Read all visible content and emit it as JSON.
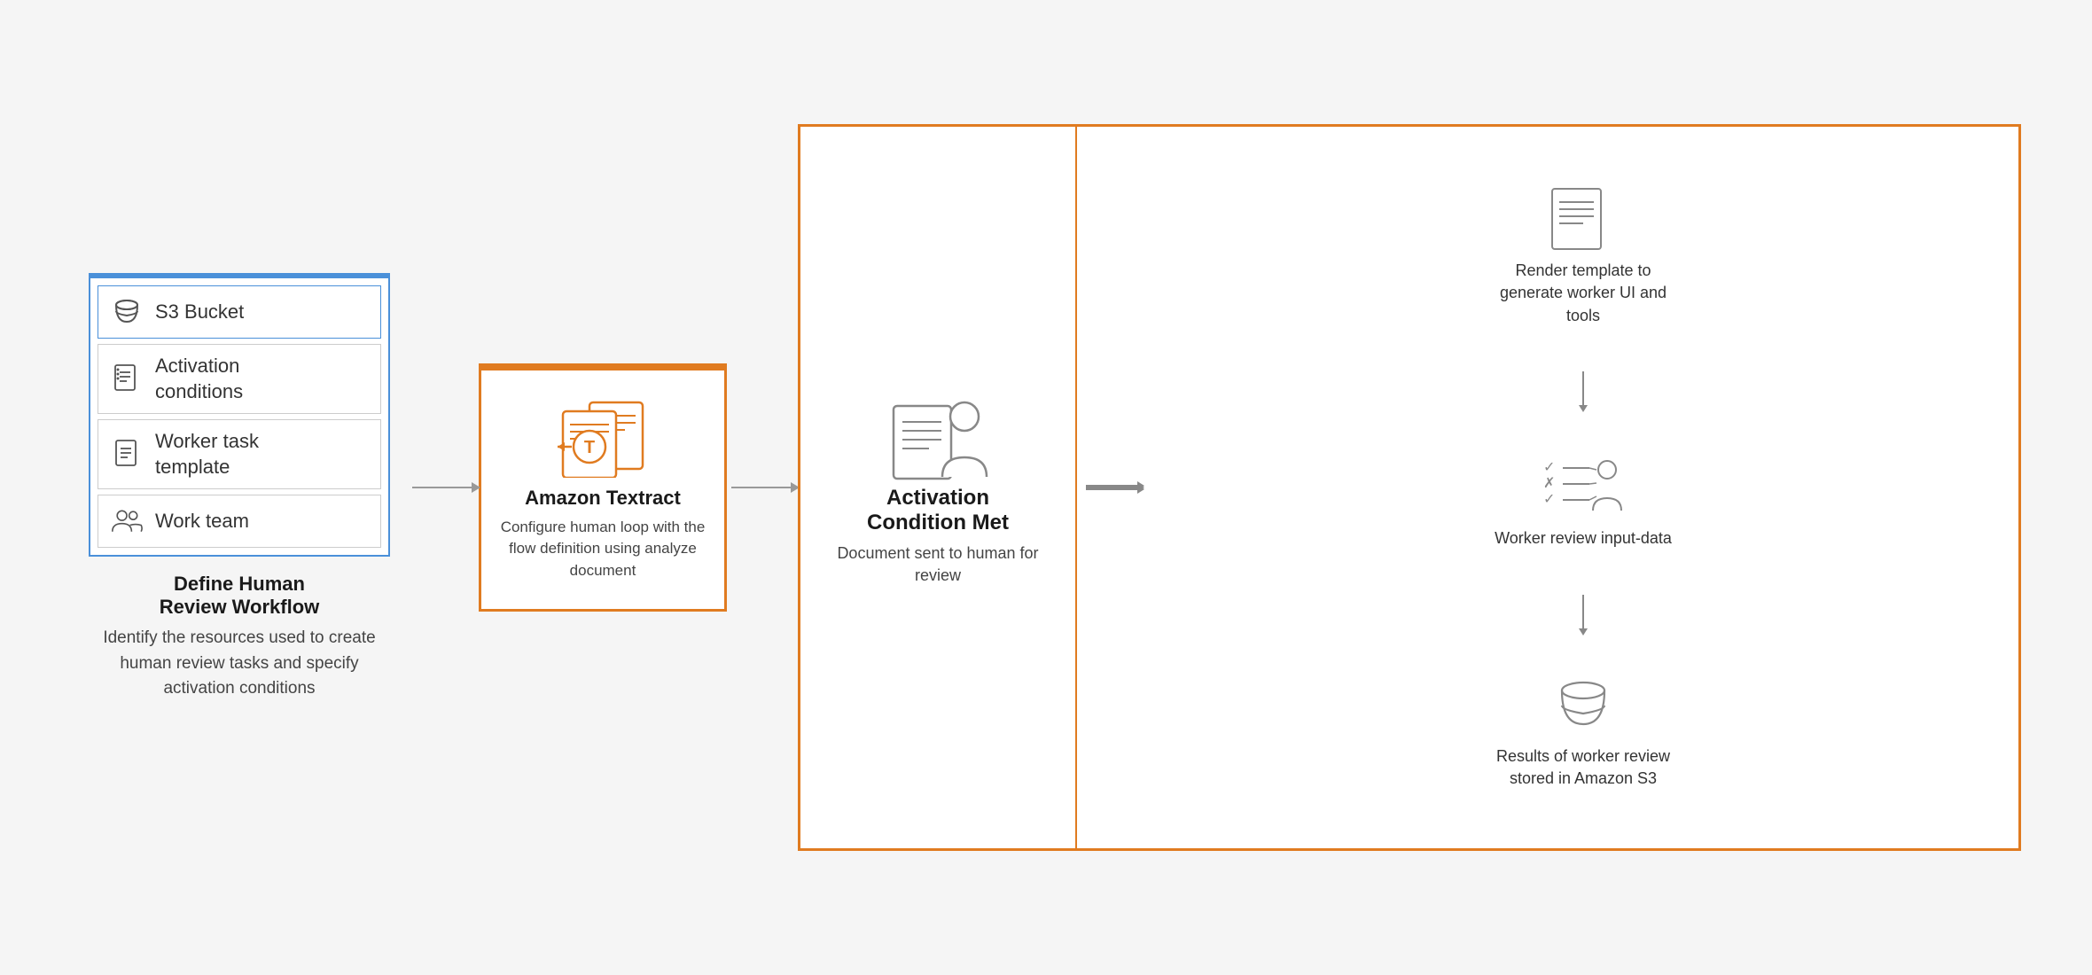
{
  "left_panel": {
    "items": [
      {
        "id": "s3",
        "label": "S3 Bucket",
        "icon": "bucket"
      },
      {
        "id": "activation",
        "label": "Activation\nconditions",
        "icon": "doc-list"
      },
      {
        "id": "worker-task",
        "label": "Worker task\ntemplate",
        "icon": "doc"
      },
      {
        "id": "work-team",
        "label": "Work team",
        "icon": "people"
      }
    ],
    "description_title": "Define Human\nReview Workflow",
    "description_subtitle": "Identify the resources used to create human review tasks and specify activation conditions"
  },
  "textract": {
    "title": "Amazon Textract",
    "desc": "Configure human loop with the flow definition using analyze document"
  },
  "activation": {
    "title": "Activation\nCondition Met",
    "desc": "Document sent to human for review"
  },
  "outcomes": [
    {
      "icon": "template-doc",
      "label": "Render template to generate worker UI and tools"
    },
    {
      "icon": "worker-review",
      "label": "Worker review input-data"
    },
    {
      "icon": "bucket",
      "label": "Results of worker review stored in Amazon S3"
    }
  ]
}
